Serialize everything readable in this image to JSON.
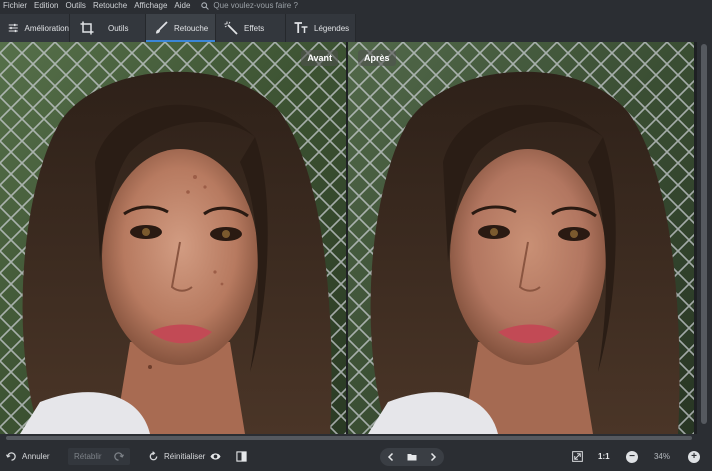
{
  "menu": {
    "items": [
      "Fichier",
      "Edition",
      "Outils",
      "Retouche",
      "Affichage",
      "Aide"
    ],
    "search_placeholder": "Que voulez-vous faire ?"
  },
  "toolbar": {
    "tabs": [
      {
        "label": "Amélioration",
        "icon": "sliders-icon"
      },
      {
        "label": "Outils",
        "icon": "crop-icon"
      },
      {
        "label": "Retouche",
        "icon": "brush-icon",
        "active": true
      },
      {
        "label": "Effets",
        "icon": "magic-wand-icon"
      },
      {
        "label": "Légendes",
        "icon": "text-icon"
      }
    ]
  },
  "preview": {
    "before_label": "Avant",
    "after_label": "Après"
  },
  "bottombar": {
    "undo_label": "Annuler",
    "redo_label": "Rétablir",
    "reset_label": "Réinitialiser",
    "ratio_label": "1:1",
    "zoom_value": "34%"
  },
  "colors": {
    "background": "#2b2e33",
    "active_tab_accent": "#3a86d8"
  }
}
